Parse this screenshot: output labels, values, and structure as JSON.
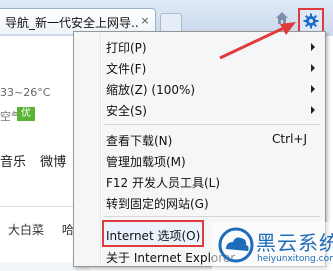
{
  "tab": {
    "title": "导航_新一代安全上网导...",
    "close": "×"
  },
  "content": {
    "weather": "33~26°C",
    "air_label": "空气",
    "air_quality": "优",
    "nav_links": [
      "音乐",
      "微博"
    ],
    "chips": [
      "大白菜",
      "哈"
    ]
  },
  "menu": {
    "items": [
      {
        "label": "打印(P)",
        "submenu": true
      },
      {
        "label": "文件(F)",
        "submenu": true
      },
      {
        "label": "缩放(Z) (100%)",
        "submenu": true
      },
      {
        "label": "安全(S)",
        "submenu": true
      },
      {
        "label": "查看下载(N)",
        "shortcut": "Ctrl+J"
      },
      {
        "label": "管理加载项(M)"
      },
      {
        "label": "F12 开发人员工具(L)"
      },
      {
        "label": "转到固定的网站(G)"
      },
      {
        "label": "Internet 选项(O)",
        "highlighted": true
      },
      {
        "label": "关于 Internet Explorer"
      }
    ]
  },
  "watermark": {
    "brand": "黑云系统",
    "url": "heiyunxitong.com"
  },
  "colors": {
    "annotation": "#e03a3a",
    "accent": "#1e6fc4"
  }
}
